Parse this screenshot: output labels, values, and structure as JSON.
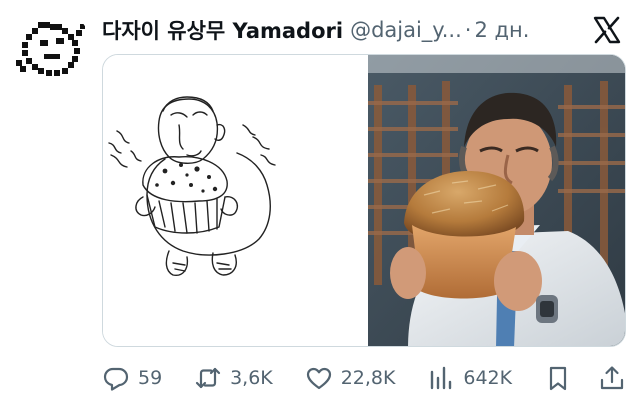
{
  "author": {
    "display_name": "다자이 유상무 Yamadori",
    "handle": "@dajai_y...",
    "separator": "·",
    "time": "2 дн."
  },
  "actions": {
    "replies": "59",
    "reposts": "3,6K",
    "likes": "22,8K",
    "views": "642K"
  },
  "icons": {
    "avatar": "pixel-face-avatar",
    "brand": "x-logo-icon",
    "reply": "reply-icon",
    "repost": "repost-icon",
    "like": "heart-icon",
    "views": "views-icon",
    "bookmark": "bookmark-icon",
    "share": "share-icon"
  },
  "colors": {
    "text": "#0f1419",
    "secondary": "#536471",
    "border": "#cfd9de"
  }
}
